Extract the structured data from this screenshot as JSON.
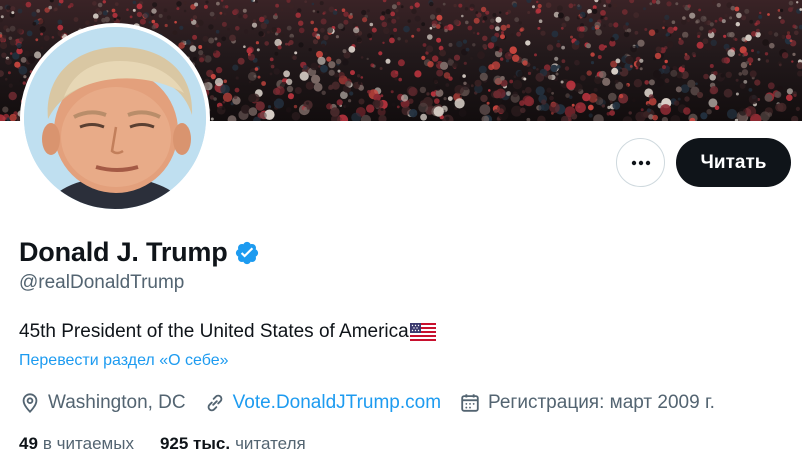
{
  "profile": {
    "name": "Donald J. Trump",
    "handle": "@realDonaldTrump",
    "bio": "45th President of the United States of America",
    "translate_link": "Перевести раздел «О себе»",
    "location": "Washington, DC",
    "website": "Vote.DonaldJTrump.com",
    "joined": "Регистрация: март 2009 г."
  },
  "actions": {
    "follow_label": "Читать",
    "more_icon": "more-horizontal-icon"
  },
  "stats": {
    "following_count": "49",
    "following_label": "в читаемых",
    "followers_count": "925 тыс.",
    "followers_label": "читателя"
  },
  "icons": {
    "verified": "verified-badge-icon",
    "flag": "us-flag-icon",
    "location": "location-pin-icon",
    "link": "link-icon",
    "calendar": "calendar-icon"
  },
  "colors": {
    "accent": "#1d9bf0",
    "text_primary": "#0f1419",
    "text_secondary": "#536471",
    "follow_button_bg": "#0f1419",
    "border": "#cfd9de"
  }
}
